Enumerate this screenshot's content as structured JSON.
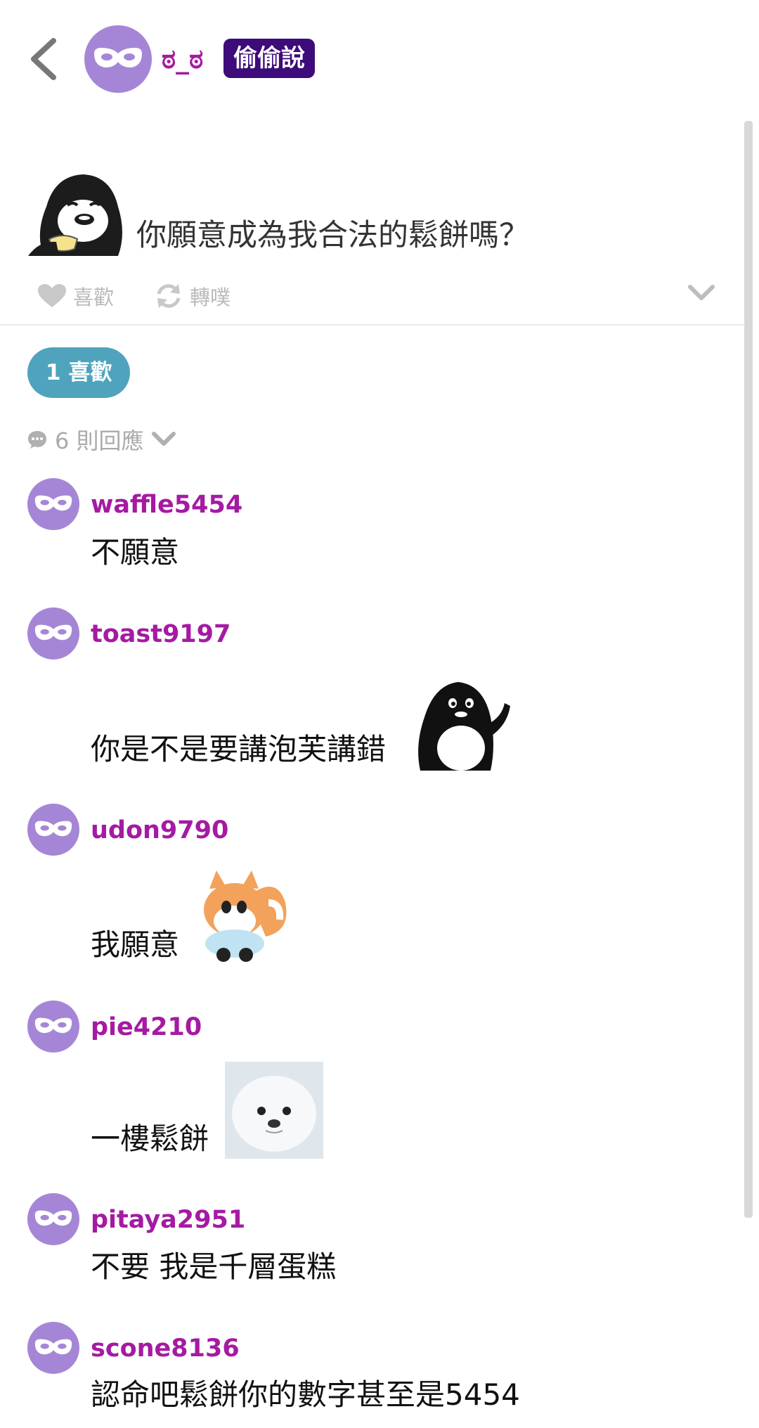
{
  "header": {
    "name": "ಠ_ಠ",
    "badge": "偷偷說"
  },
  "post": {
    "text": "你願意成為我合法的鬆餅嗎？",
    "like_label": "喜歡",
    "repost_label": "轉噗",
    "like_count_label": "1 喜歡",
    "reply_count_label": "6 則回應"
  },
  "comments": [
    {
      "user": "waffle5454",
      "text": "不願意"
    },
    {
      "user": "toast9197",
      "text": "你是不是要講泡芙講錯"
    },
    {
      "user": "udon9790",
      "text": "我願意"
    },
    {
      "user": "pie4210",
      "text": "一樓鬆餅"
    },
    {
      "user": "pitaya2951",
      "text": "不要 我是千層蛋糕"
    },
    {
      "user": "scone8136",
      "text": "認命吧鬆餅你的數字甚至是5454"
    }
  ],
  "colors": {
    "avatar": "#a586d6",
    "username": "#a51aa3",
    "badge_bg": "#3d0b7a",
    "like_pill": "#4fa3bd"
  }
}
